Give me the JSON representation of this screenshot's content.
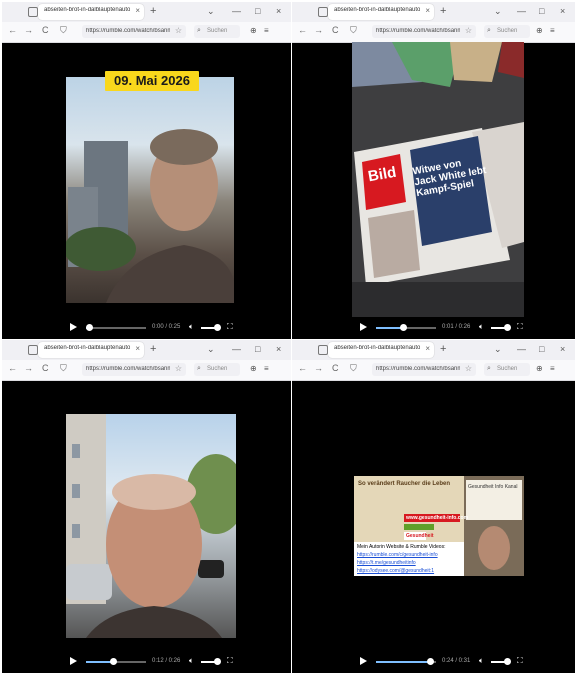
{
  "browser": {
    "tab_title": "abseiten-brot-in-dalblauptenauto",
    "new_tab": "+",
    "tab_close": "×",
    "window_controls": [
      "⌄",
      "—",
      "□",
      "×"
    ],
    "nav_back": "←",
    "nav_forward": "→",
    "nav_reload": "C",
    "url": "https://rumble.com/watch/bsanm",
    "search_placeholder": "Suchen",
    "right_icons": [
      "⊕",
      "≡"
    ]
  },
  "videos": [
    {
      "badge": "09. Mai 2026",
      "time": "0:00 / 0:25",
      "progress": 0.05
    },
    {
      "time": "0:01 / 0:26",
      "progress": 0.45
    },
    {
      "time": "0:12 / 0:26",
      "progress": 0.45
    },
    {
      "time": "0:24 / 0:31",
      "progress": 0.9
    }
  ],
  "newspaper": {
    "brand": "Bild",
    "headline": "Witwe von Jack White lebt Kampf-Spiel"
  },
  "promo": {
    "heading": "So verändert Raucher die Leben",
    "site": "www.gesundheit-info.com",
    "red_label": "Gesundheit",
    "lines": [
      "Mein Autorin Website & Rumble Videos:",
      "https://rumble.com/c/gesundheit-info",
      "https://t.me/gesundheitinfo",
      "https://odysee.com/@gesundheit:1"
    ],
    "side_note": "Gesundheit Info Kanal"
  },
  "colors": {
    "accent": "#f9d71c",
    "progress": "#7fbfff"
  }
}
